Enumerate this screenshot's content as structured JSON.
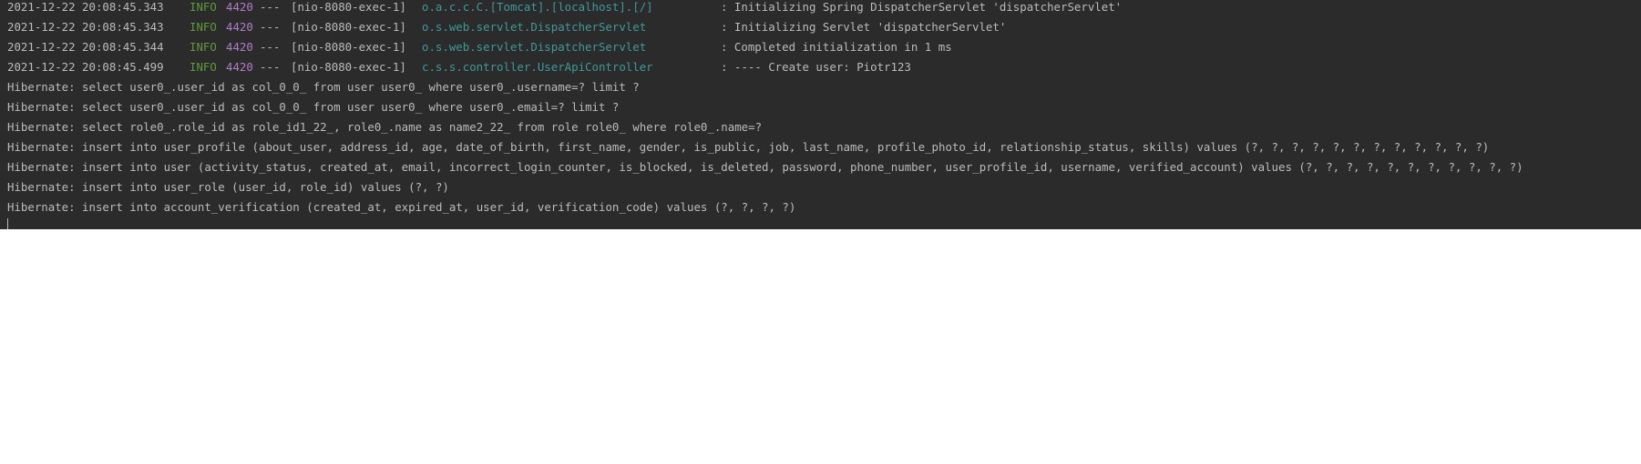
{
  "log_lines": [
    {
      "timestamp": "2021-12-22 20:08:45.343",
      "level": "INFO",
      "pid": "4420",
      "separator": "---",
      "thread": "[nio-8080-exec-1]",
      "logger": "o.a.c.c.C.[Tomcat].[localhost].[/]",
      "message": ": Initializing Spring DispatcherServlet 'dispatcherServlet'"
    },
    {
      "timestamp": "2021-12-22 20:08:45.343",
      "level": "INFO",
      "pid": "4420",
      "separator": "---",
      "thread": "[nio-8080-exec-1]",
      "logger": "o.s.web.servlet.DispatcherServlet",
      "message": ": Initializing Servlet 'dispatcherServlet'"
    },
    {
      "timestamp": "2021-12-22 20:08:45.344",
      "level": "INFO",
      "pid": "4420",
      "separator": "---",
      "thread": "[nio-8080-exec-1]",
      "logger": "o.s.web.servlet.DispatcherServlet",
      "message": ": Completed initialization in 1 ms"
    },
    {
      "timestamp": "2021-12-22 20:08:45.499",
      "level": "INFO",
      "pid": "4420",
      "separator": "---",
      "thread": "[nio-8080-exec-1]",
      "logger": "c.s.s.controller.UserApiController",
      "message": ": ---- Create user: Piotr123"
    }
  ],
  "sql_lines": [
    "Hibernate: select user0_.user_id as col_0_0_ from user user0_ where user0_.username=? limit ?",
    "Hibernate: select user0_.user_id as col_0_0_ from user user0_ where user0_.email=? limit ?",
    "Hibernate: select role0_.role_id as role_id1_22_, role0_.name as name2_22_ from role role0_ where role0_.name=?",
    "Hibernate: insert into user_profile (about_user, address_id, age, date_of_birth, first_name, gender, is_public, job, last_name, profile_photo_id, relationship_status, skills) values (?, ?, ?, ?, ?, ?, ?, ?, ?, ?, ?, ?)",
    "Hibernate: insert into user (activity_status, created_at, email, incorrect_login_counter, is_blocked, is_deleted, password, phone_number, user_profile_id, username, verified_account) values (?, ?, ?, ?, ?, ?, ?, ?, ?, ?, ?)",
    "Hibernate: insert into user_role (user_id, role_id) values (?, ?)",
    "Hibernate: insert into account_verification (created_at, expired_at, user_id, verification_code) values (?, ?, ?, ?)"
  ],
  "colors": {
    "background": "#2b2b2b",
    "text": "#bbbbbb",
    "level_info": "#5f9b3a",
    "pid": "#b07dc9",
    "logger": "#3d9a9a"
  }
}
